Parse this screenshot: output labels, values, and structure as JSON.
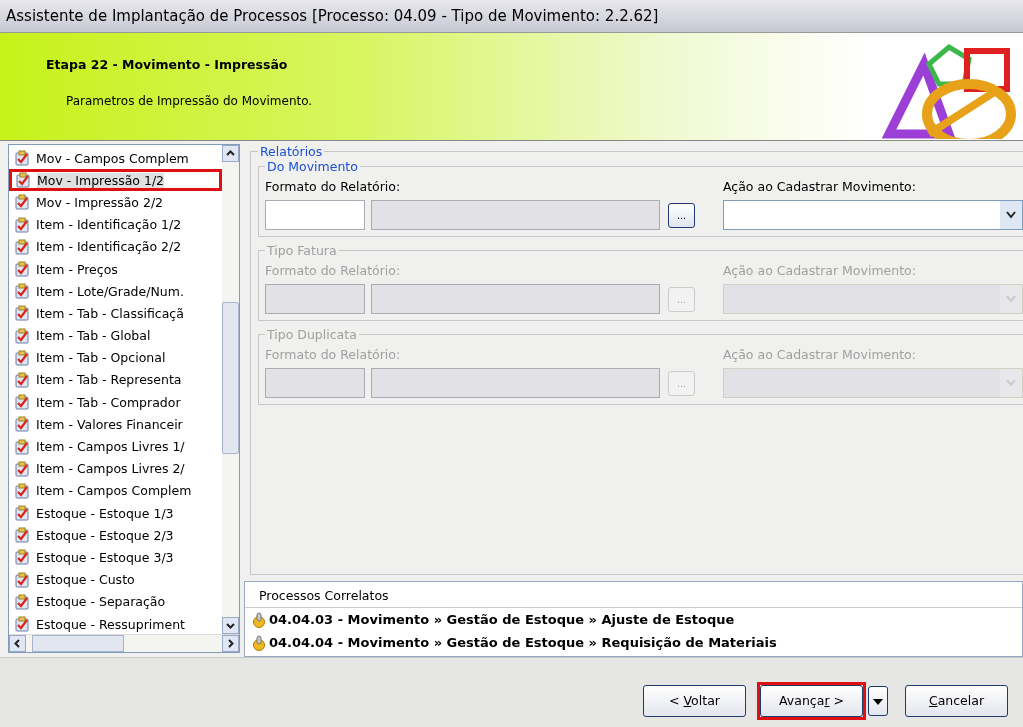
{
  "window": {
    "title": "Assistente de Implantação de Processos [Processo: 04.09 - Tipo de Movimento: 2.2.62]"
  },
  "header": {
    "step": "Etapa 22 - Movimento - Impressão",
    "description": "Parametros de Impressão do Movimento."
  },
  "steps": [
    {
      "label": "Mov - Campos Complem",
      "selected": false,
      "highlighted": false
    },
    {
      "label": "Mov - Impressão 1/2",
      "selected": true,
      "highlighted": true
    },
    {
      "label": "Mov - Impressão 2/2",
      "selected": false,
      "highlighted": false
    },
    {
      "label": "Item - Identificação 1/2",
      "selected": false,
      "highlighted": false
    },
    {
      "label": "Item - Identificação 2/2",
      "selected": false,
      "highlighted": false
    },
    {
      "label": "Item - Preços",
      "selected": false,
      "highlighted": false
    },
    {
      "label": "Item - Lote/Grade/Num.",
      "selected": false,
      "highlighted": false
    },
    {
      "label": "Item - Tab - Classificaçã",
      "selected": false,
      "highlighted": false
    },
    {
      "label": "Item - Tab - Global",
      "selected": false,
      "highlighted": false
    },
    {
      "label": "Item - Tab - Opcional",
      "selected": false,
      "highlighted": false
    },
    {
      "label": "Item - Tab - Representa",
      "selected": false,
      "highlighted": false
    },
    {
      "label": "Item - Tab - Comprador",
      "selected": false,
      "highlighted": false
    },
    {
      "label": "Item - Valores Financeir",
      "selected": false,
      "highlighted": false
    },
    {
      "label": "Item - Campos Livres 1/",
      "selected": false,
      "highlighted": false
    },
    {
      "label": "Item - Campos Livres 2/",
      "selected": false,
      "highlighted": false
    },
    {
      "label": "Item - Campos Complem",
      "selected": false,
      "highlighted": false
    },
    {
      "label": "Estoque - Estoque 1/3",
      "selected": false,
      "highlighted": false
    },
    {
      "label": "Estoque - Estoque 2/3",
      "selected": false,
      "highlighted": false
    },
    {
      "label": "Estoque - Estoque 3/3",
      "selected": false,
      "highlighted": false
    },
    {
      "label": "Estoque - Custo",
      "selected": false,
      "highlighted": false
    },
    {
      "label": "Estoque - Separação",
      "selected": false,
      "highlighted": false
    },
    {
      "label": "Estoque - Ressupriment",
      "selected": false,
      "highlighted": false
    }
  ],
  "reports": {
    "title": "Relatórios",
    "groups": [
      {
        "title": "Do Movimento",
        "disabled": false,
        "format_label": "Formato do Relatório:",
        "browse_button": "...",
        "action_label": "Ação ao Cadastrar Movimento:"
      },
      {
        "title": "Tipo Fatura",
        "disabled": true,
        "format_label": "Formato do Relatório:",
        "browse_button": "...",
        "action_label": "Ação ao Cadastrar Movimento:"
      },
      {
        "title": "Tipo Duplicata",
        "disabled": true,
        "format_label": "Formato do Relatório:",
        "browse_button": "...",
        "action_label": "Ação ao Cadastrar Movimento:"
      }
    ]
  },
  "related": {
    "title": "Processos Correlatos",
    "items": [
      "04.04.03 - Movimento » Gestão de Estoque » Ajuste de Estoque",
      "04.04.04 - Movimento » Gestão de Estoque » Requisição de Materiais"
    ]
  },
  "buttons": [
    {
      "kind": "plain",
      "parts": [
        "< ",
        "V",
        "oltar"
      ],
      "highlighted": false
    },
    {
      "kind": "split",
      "parts": [
        "Avança",
        "r",
        " >"
      ],
      "highlighted": true
    },
    {
      "kind": "plain",
      "parts": [
        "C",
        "ancelar"
      ],
      "highlighted": false,
      "key_first": true
    }
  ]
}
